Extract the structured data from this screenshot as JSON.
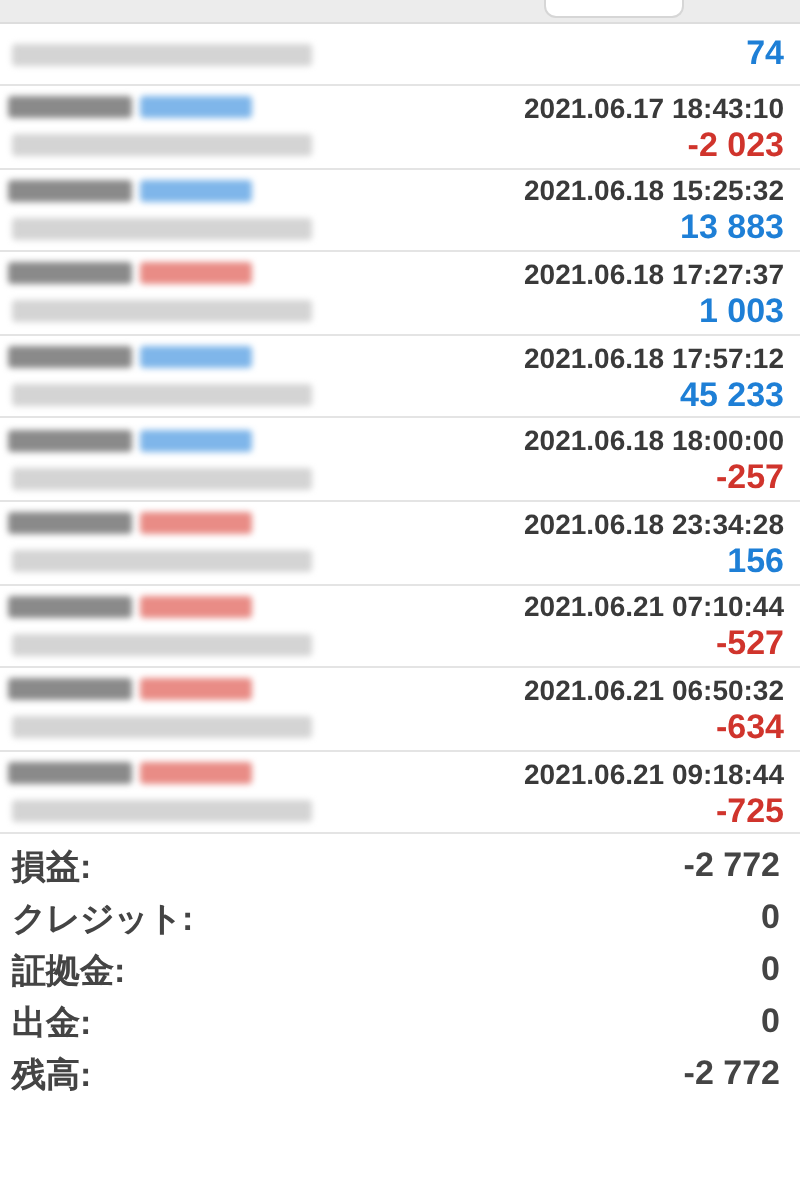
{
  "trades": [
    {
      "profit": "74",
      "loss": false
    },
    {
      "buy": true,
      "time": "2021.06.17 18:43:10",
      "profit": "-2 023",
      "loss": true
    },
    {
      "buy": true,
      "time": "2021.06.18 15:25:32",
      "profit": "13 883",
      "loss": false
    },
    {
      "buy": false,
      "time": "2021.06.18 17:27:37",
      "profit": "1 003",
      "loss": false
    },
    {
      "buy": true,
      "time": "2021.06.18 17:57:12",
      "profit": "45 233",
      "loss": false
    },
    {
      "buy": true,
      "time": "2021.06.18 18:00:00",
      "profit": "-257",
      "loss": true
    },
    {
      "buy": false,
      "time": "2021.06.18 23:34:28",
      "profit": "156",
      "loss": false
    },
    {
      "buy": false,
      "time": "2021.06.21 07:10:44",
      "profit": "-527",
      "loss": true
    },
    {
      "buy": false,
      "time": "2021.06.21 06:50:32",
      "profit": "-634",
      "loss": true
    },
    {
      "buy": false,
      "time": "2021.06.21 09:18:44",
      "profit": "-725",
      "loss": true
    }
  ],
  "summary": [
    {
      "label": "損益:",
      "value": "-2 772"
    },
    {
      "label": "クレジット:",
      "value": "0"
    },
    {
      "label": "証拠金:",
      "value": "0"
    },
    {
      "label": "出金:",
      "value": "0"
    },
    {
      "label": "残高:",
      "value": "-2 772"
    }
  ]
}
